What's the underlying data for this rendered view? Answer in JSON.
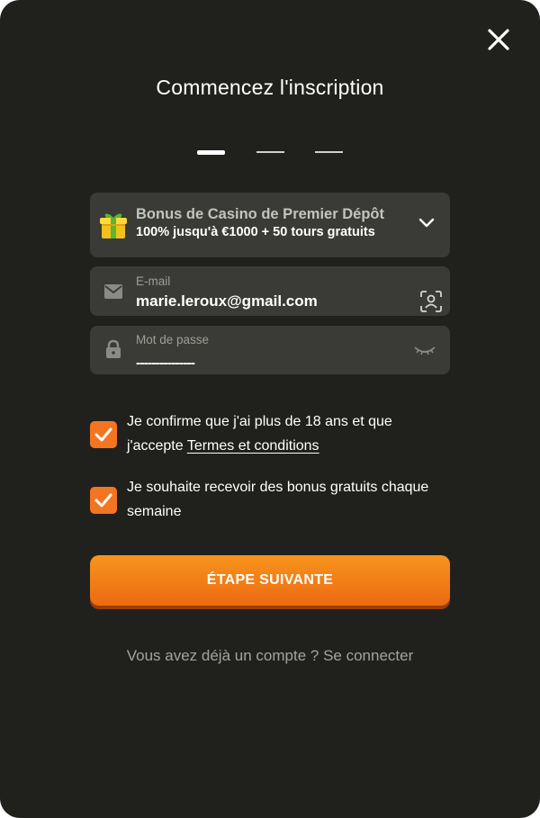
{
  "modal": {
    "title": "Commencez l'inscription",
    "steps": [
      {
        "state": "active"
      },
      {
        "state": "inactive"
      },
      {
        "state": "inactive"
      }
    ]
  },
  "bonus": {
    "title": "Bonus de Casino de Premier Dépôt",
    "subtitle": "100% jusqu'à €1000 + 50 tours gratuits",
    "icon": "gift-icon",
    "expand_icon": "chevron-down-icon"
  },
  "email": {
    "label": "E-mail",
    "value": "marie.leroux@gmail.com",
    "icon": "envelope-icon",
    "trailing_icon": "face-scan-icon"
  },
  "password": {
    "label": "Mot de passe",
    "masked_value": "---------------",
    "icon": "lock-icon",
    "trailing_icon": "eye-closed-icon"
  },
  "consents": [
    {
      "checked": true,
      "text": "Je confirme que j'ai plus de 18 ans et que j'accepte",
      "link": "Termes et conditions"
    },
    {
      "checked": true,
      "text": "Je souhaite recevoir des bonus gratuits chaque semaine"
    }
  ],
  "cta": {
    "label": "ÉTAPE SUIVANTE"
  },
  "login": {
    "prompt": "Vous avez déjà un compte ?",
    "link": "Se connecter"
  },
  "colors": {
    "background": "#20211d",
    "field": "#3a3b36",
    "accent": "#f47521"
  }
}
